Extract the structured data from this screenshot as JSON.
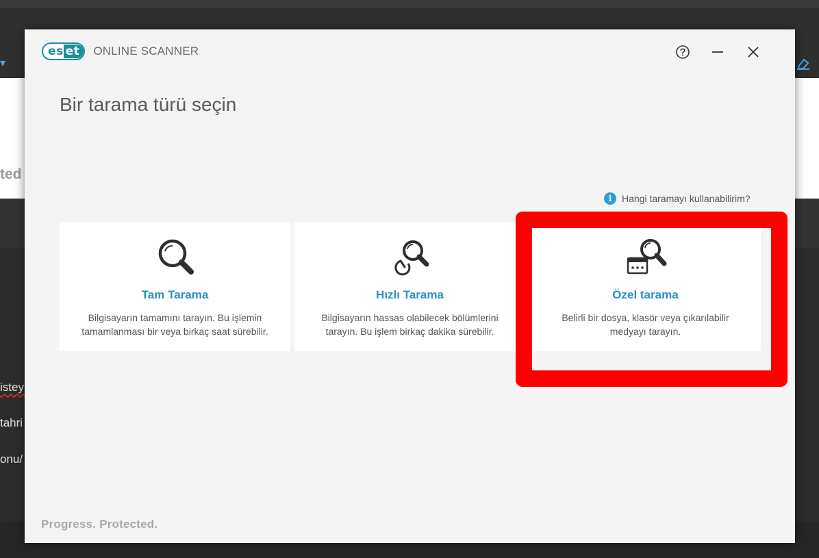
{
  "background": {
    "ghost_text": "ted",
    "line1": "isteyi",
    "line2": "tahri",
    "line3": "onu/"
  },
  "dialog": {
    "logo_badge": "eset",
    "logo_badge_part1": "es",
    "logo_badge_part2": "et",
    "app_name": "ONLINE SCANNER",
    "help_icon": "help-circle-icon",
    "minimize_icon": "minimize-icon",
    "close_icon": "close-icon",
    "title": "Bir tarama türü seçin",
    "help_link": "Hangi taramayı kullanabilirim?",
    "tagline": "Progress. Protected."
  },
  "cards": [
    {
      "icon": "magnifier-icon",
      "title": "Tam Tarama",
      "description": "Bilgisayarın tamamını tarayın. Bu işlemin tamamlanması bir veya birkaç saat sürebilir."
    },
    {
      "icon": "quick-scan-icon",
      "title": "Hızlı Tarama",
      "description": "Bilgisayarın hassas olabilecek bölümlerini tarayın. Bu işlem birkaç dakika sürebilir."
    },
    {
      "icon": "custom-scan-icon",
      "title": "Özel tarama",
      "description": "Belirli bir dosya, klasör veya çıkarılabilir medyayı tarayın."
    }
  ],
  "colors": {
    "brand": "#1f8e9c",
    "link": "#2b93c5",
    "highlight": "#ff0000"
  }
}
